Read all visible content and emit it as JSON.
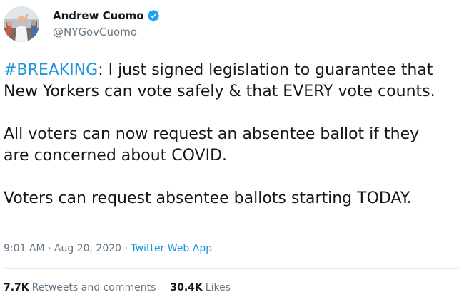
{
  "author": {
    "display_name": "Andrew Cuomo",
    "handle": "@NYGovCuomo",
    "verified_icon": "verified-badge-icon",
    "avatar_icon": "profile-photo"
  },
  "tweet": {
    "hashtag": "#BREAKING",
    "line1_rest": ": I just signed legislation to guarantee that",
    "line2": "New Yorkers can vote safely & that EVERY vote counts.",
    "line3": "All voters can now request an absentee ballot if they",
    "line4": "are concerned about COVID.",
    "line5": "Voters can request absentee ballots starting TODAY."
  },
  "meta": {
    "time": "9:01 AM",
    "separator1": " · ",
    "date": "Aug 20, 2020",
    "separator2": " · ",
    "source": "Twitter Web App"
  },
  "stats": {
    "retweets_count": "7.7K",
    "retweets_label": "Retweets and comments",
    "likes_count": "30.4K",
    "likes_label": "Likes"
  },
  "colors": {
    "link": "#1b95e0",
    "text": "#14171a",
    "secondary": "#657786",
    "verified": "#1da1f2",
    "divider": "#e6ecf0"
  }
}
